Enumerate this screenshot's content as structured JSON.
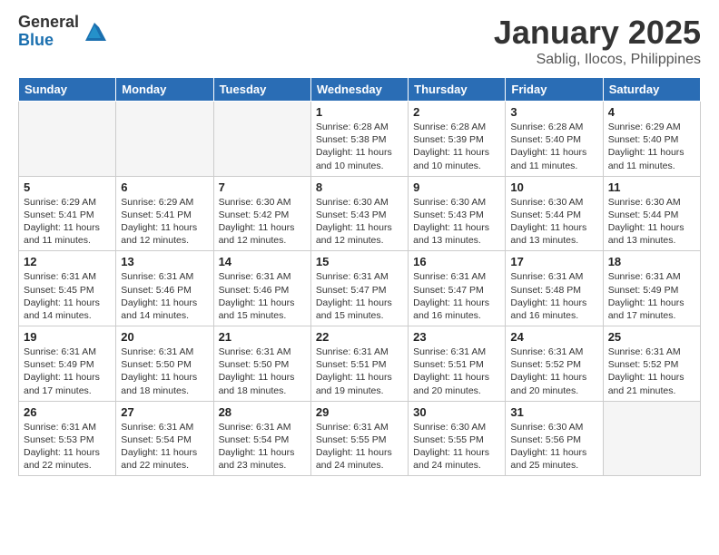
{
  "logo": {
    "general": "General",
    "blue": "Blue"
  },
  "title": {
    "month": "January 2025",
    "location": "Sablig, Ilocos, Philippines"
  },
  "weekdays": [
    "Sunday",
    "Monday",
    "Tuesday",
    "Wednesday",
    "Thursday",
    "Friday",
    "Saturday"
  ],
  "weeks": [
    [
      {
        "day": "",
        "info": ""
      },
      {
        "day": "",
        "info": ""
      },
      {
        "day": "",
        "info": ""
      },
      {
        "day": "1",
        "info": "Sunrise: 6:28 AM\nSunset: 5:38 PM\nDaylight: 11 hours\nand 10 minutes."
      },
      {
        "day": "2",
        "info": "Sunrise: 6:28 AM\nSunset: 5:39 PM\nDaylight: 11 hours\nand 10 minutes."
      },
      {
        "day": "3",
        "info": "Sunrise: 6:28 AM\nSunset: 5:40 PM\nDaylight: 11 hours\nand 11 minutes."
      },
      {
        "day": "4",
        "info": "Sunrise: 6:29 AM\nSunset: 5:40 PM\nDaylight: 11 hours\nand 11 minutes."
      }
    ],
    [
      {
        "day": "5",
        "info": "Sunrise: 6:29 AM\nSunset: 5:41 PM\nDaylight: 11 hours\nand 11 minutes."
      },
      {
        "day": "6",
        "info": "Sunrise: 6:29 AM\nSunset: 5:41 PM\nDaylight: 11 hours\nand 12 minutes."
      },
      {
        "day": "7",
        "info": "Sunrise: 6:30 AM\nSunset: 5:42 PM\nDaylight: 11 hours\nand 12 minutes."
      },
      {
        "day": "8",
        "info": "Sunrise: 6:30 AM\nSunset: 5:43 PM\nDaylight: 11 hours\nand 12 minutes."
      },
      {
        "day": "9",
        "info": "Sunrise: 6:30 AM\nSunset: 5:43 PM\nDaylight: 11 hours\nand 13 minutes."
      },
      {
        "day": "10",
        "info": "Sunrise: 6:30 AM\nSunset: 5:44 PM\nDaylight: 11 hours\nand 13 minutes."
      },
      {
        "day": "11",
        "info": "Sunrise: 6:30 AM\nSunset: 5:44 PM\nDaylight: 11 hours\nand 13 minutes."
      }
    ],
    [
      {
        "day": "12",
        "info": "Sunrise: 6:31 AM\nSunset: 5:45 PM\nDaylight: 11 hours\nand 14 minutes."
      },
      {
        "day": "13",
        "info": "Sunrise: 6:31 AM\nSunset: 5:46 PM\nDaylight: 11 hours\nand 14 minutes."
      },
      {
        "day": "14",
        "info": "Sunrise: 6:31 AM\nSunset: 5:46 PM\nDaylight: 11 hours\nand 15 minutes."
      },
      {
        "day": "15",
        "info": "Sunrise: 6:31 AM\nSunset: 5:47 PM\nDaylight: 11 hours\nand 15 minutes."
      },
      {
        "day": "16",
        "info": "Sunrise: 6:31 AM\nSunset: 5:47 PM\nDaylight: 11 hours\nand 16 minutes."
      },
      {
        "day": "17",
        "info": "Sunrise: 6:31 AM\nSunset: 5:48 PM\nDaylight: 11 hours\nand 16 minutes."
      },
      {
        "day": "18",
        "info": "Sunrise: 6:31 AM\nSunset: 5:49 PM\nDaylight: 11 hours\nand 17 minutes."
      }
    ],
    [
      {
        "day": "19",
        "info": "Sunrise: 6:31 AM\nSunset: 5:49 PM\nDaylight: 11 hours\nand 17 minutes."
      },
      {
        "day": "20",
        "info": "Sunrise: 6:31 AM\nSunset: 5:50 PM\nDaylight: 11 hours\nand 18 minutes."
      },
      {
        "day": "21",
        "info": "Sunrise: 6:31 AM\nSunset: 5:50 PM\nDaylight: 11 hours\nand 18 minutes."
      },
      {
        "day": "22",
        "info": "Sunrise: 6:31 AM\nSunset: 5:51 PM\nDaylight: 11 hours\nand 19 minutes."
      },
      {
        "day": "23",
        "info": "Sunrise: 6:31 AM\nSunset: 5:51 PM\nDaylight: 11 hours\nand 20 minutes."
      },
      {
        "day": "24",
        "info": "Sunrise: 6:31 AM\nSunset: 5:52 PM\nDaylight: 11 hours\nand 20 minutes."
      },
      {
        "day": "25",
        "info": "Sunrise: 6:31 AM\nSunset: 5:52 PM\nDaylight: 11 hours\nand 21 minutes."
      }
    ],
    [
      {
        "day": "26",
        "info": "Sunrise: 6:31 AM\nSunset: 5:53 PM\nDaylight: 11 hours\nand 22 minutes."
      },
      {
        "day": "27",
        "info": "Sunrise: 6:31 AM\nSunset: 5:54 PM\nDaylight: 11 hours\nand 22 minutes."
      },
      {
        "day": "28",
        "info": "Sunrise: 6:31 AM\nSunset: 5:54 PM\nDaylight: 11 hours\nand 23 minutes."
      },
      {
        "day": "29",
        "info": "Sunrise: 6:31 AM\nSunset: 5:55 PM\nDaylight: 11 hours\nand 24 minutes."
      },
      {
        "day": "30",
        "info": "Sunrise: 6:30 AM\nSunset: 5:55 PM\nDaylight: 11 hours\nand 24 minutes."
      },
      {
        "day": "31",
        "info": "Sunrise: 6:30 AM\nSunset: 5:56 PM\nDaylight: 11 hours\nand 25 minutes."
      },
      {
        "day": "",
        "info": ""
      }
    ]
  ]
}
